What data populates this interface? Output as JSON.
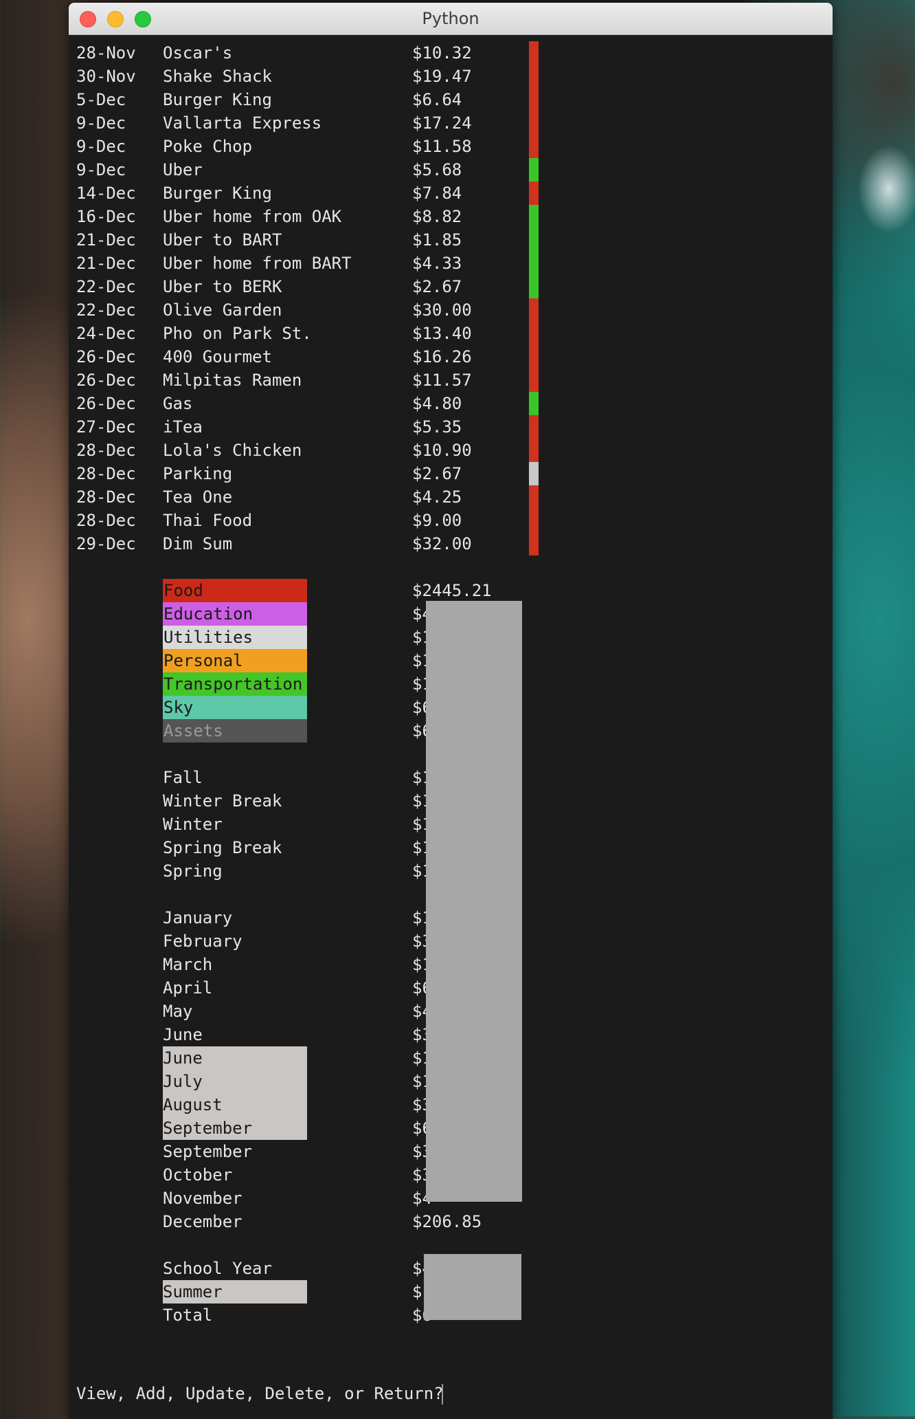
{
  "window": {
    "title": "Python"
  },
  "transactions": [
    {
      "date": "28-Nov",
      "desc": "Oscar's",
      "amount": "$10.32",
      "category": "Food"
    },
    {
      "date": "30-Nov",
      "desc": "Shake Shack",
      "amount": "$19.47",
      "category": "Food"
    },
    {
      "date": "5-Dec",
      "desc": "Burger King",
      "amount": "$6.64",
      "category": "Food"
    },
    {
      "date": "9-Dec",
      "desc": "Vallarta Express",
      "amount": "$17.24",
      "category": "Food"
    },
    {
      "date": "9-Dec",
      "desc": "Poke Chop",
      "amount": "$11.58",
      "category": "Food"
    },
    {
      "date": "9-Dec",
      "desc": "Uber",
      "amount": "$5.68",
      "category": "Transportation"
    },
    {
      "date": "14-Dec",
      "desc": "Burger King",
      "amount": "$7.84",
      "category": "Food"
    },
    {
      "date": "16-Dec",
      "desc": "Uber home from OAK",
      "amount": "$8.82",
      "category": "Transportation"
    },
    {
      "date": "21-Dec",
      "desc": "Uber to BART",
      "amount": "$1.85",
      "category": "Transportation"
    },
    {
      "date": "21-Dec",
      "desc": "Uber home from BART",
      "amount": "$4.33",
      "category": "Transportation"
    },
    {
      "date": "22-Dec",
      "desc": "Uber to BERK",
      "amount": "$2.67",
      "category": "Transportation"
    },
    {
      "date": "22-Dec",
      "desc": "Olive Garden",
      "amount": "$30.00",
      "category": "Food"
    },
    {
      "date": "24-Dec",
      "desc": "Pho on Park St.",
      "amount": "$13.40",
      "category": "Food"
    },
    {
      "date": "26-Dec",
      "desc": "400 Gourmet",
      "amount": "$16.26",
      "category": "Food"
    },
    {
      "date": "26-Dec",
      "desc": "Milpitas Ramen",
      "amount": "$11.57",
      "category": "Food"
    },
    {
      "date": "26-Dec",
      "desc": "Gas",
      "amount": "$4.80",
      "category": "Transportation"
    },
    {
      "date": "27-Dec",
      "desc": "iTea",
      "amount": "$5.35",
      "category": "Food"
    },
    {
      "date": "28-Dec",
      "desc": "Lola's Chicken",
      "amount": "$10.90",
      "category": "Food"
    },
    {
      "date": "28-Dec",
      "desc": "Parking",
      "amount": "$2.67",
      "category": "Utilities"
    },
    {
      "date": "28-Dec",
      "desc": "Tea One",
      "amount": "$4.25",
      "category": "Food"
    },
    {
      "date": "28-Dec",
      "desc": "Thai Food",
      "amount": "$9.00",
      "category": "Food"
    },
    {
      "date": "29-Dec",
      "desc": "Dim Sum",
      "amount": "$32.00",
      "category": "Food"
    }
  ],
  "categories": [
    {
      "name": "Food",
      "amount": "$2445.21",
      "bg": "#cc2a18",
      "fg": "#1a1a1a"
    },
    {
      "name": "Education",
      "amount": "$4",
      "bg": "#cc5fe6",
      "fg": "#1a1a1a"
    },
    {
      "name": "Utilities",
      "amount": "$1",
      "bg": "#d9d9d9",
      "fg": "#1a1a1a"
    },
    {
      "name": "Personal",
      "amount": "$1",
      "bg": "#f0a020",
      "fg": "#1a1a1a"
    },
    {
      "name": "Transportation",
      "amount": "$1",
      "bg": "#44c528",
      "fg": "#1a1a1a"
    },
    {
      "name": "Sky",
      "amount": "$6",
      "bg": "#5ec8a8",
      "fg": "#1a1a1a"
    },
    {
      "name": "Assets",
      "amount": "$6",
      "bg": "#555555",
      "fg": "#9a9a9a"
    }
  ],
  "seasons": [
    {
      "name": "Fall",
      "amount": "$1"
    },
    {
      "name": "Winter Break",
      "amount": "$1"
    },
    {
      "name": "Winter",
      "amount": "$1"
    },
    {
      "name": "Spring Break",
      "amount": "$1"
    },
    {
      "name": "Spring",
      "amount": "$1"
    }
  ],
  "months": [
    {
      "name": "January",
      "amount": "$1",
      "highlight": false
    },
    {
      "name": "February",
      "amount": "$3",
      "highlight": false
    },
    {
      "name": "March",
      "amount": "$1",
      "highlight": false
    },
    {
      "name": "April",
      "amount": "$6",
      "highlight": false
    },
    {
      "name": "May",
      "amount": "$4",
      "highlight": false
    },
    {
      "name": "June",
      "amount": "$3",
      "highlight": false
    },
    {
      "name": "June",
      "amount": "$1",
      "highlight": true
    },
    {
      "name": "July",
      "amount": "$1",
      "highlight": true
    },
    {
      "name": "August",
      "amount": "$3",
      "highlight": true
    },
    {
      "name": "September",
      "amount": "$6",
      "highlight": true
    },
    {
      "name": "September",
      "amount": "$3",
      "highlight": false
    },
    {
      "name": "October",
      "amount": "$3",
      "highlight": false
    },
    {
      "name": "November",
      "amount": "$4",
      "highlight": false
    },
    {
      "name": "December",
      "amount": "$206.85",
      "highlight": false
    }
  ],
  "summary": [
    {
      "name": "School Year",
      "amount": "$4",
      "highlight": false
    },
    {
      "name": "Summer",
      "amount": "$",
      "highlight": true
    },
    {
      "name": "Total",
      "amount": "$6",
      "highlight": false
    }
  ],
  "colors": {
    "Food": "#d0321d",
    "Transportation": "#3ac62a",
    "Utilities": "#c8c8c8",
    "redaction": "#a7a7a7",
    "highlight": "#c9c6c4"
  },
  "prompt": "View, Add, Update, Delete, or Return? "
}
